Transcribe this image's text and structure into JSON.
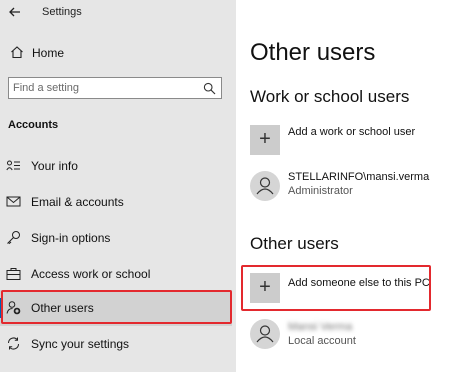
{
  "window": {
    "title": "Settings"
  },
  "sidebar": {
    "home_label": "Home",
    "search_placeholder": "Find a setting",
    "section_header": "Accounts",
    "items": [
      {
        "label": "Your info",
        "icon": "your-info-icon"
      },
      {
        "label": "Email & accounts",
        "icon": "email-icon"
      },
      {
        "label": "Sign-in options",
        "icon": "key-icon"
      },
      {
        "label": "Access work or school",
        "icon": "briefcase-icon"
      },
      {
        "label": "Other users",
        "icon": "add-person-icon",
        "selected": true
      },
      {
        "label": "Sync your settings",
        "icon": "sync-icon"
      }
    ]
  },
  "main": {
    "title": "Other users",
    "work_section": {
      "heading": "Work or school users",
      "add_label": "Add a work or school user",
      "user_name": "STELLARINFO\\mansi.verma",
      "user_role": "Administrator"
    },
    "other_section": {
      "heading": "Other users",
      "add_label": "Add someone else to this PC",
      "user_name": "Mansi Verma",
      "user_role": "Local account"
    }
  },
  "colors": {
    "sidebar_bg": "#e6e6e6",
    "accent": "#0063b1",
    "highlight": "#e3292e",
    "tile_bg": "#cccccc"
  }
}
